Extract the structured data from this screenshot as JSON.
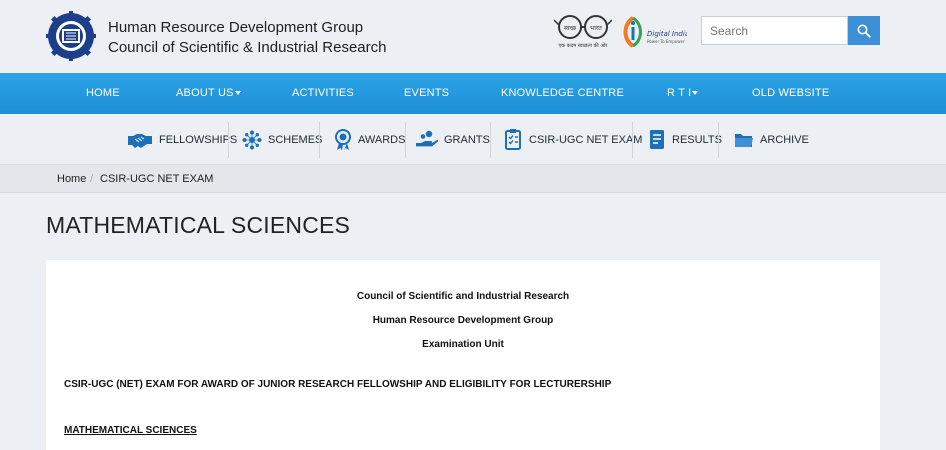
{
  "header": {
    "org_line1": "Human Resource Development Group",
    "org_line2": "Council of Scientific & Industrial Research",
    "swachh_text": "एक कदम स्वच्छता की ओर",
    "swachh_badge_left": "स्वच्छ",
    "swachh_badge_right": "भारत",
    "digital_india_title": "Digital India",
    "digital_india_sub": "Power To Empower",
    "search_placeholder": "Search"
  },
  "main_nav": {
    "home": "HOME",
    "about": "ABOUT US",
    "activities": "ACTIVITIES",
    "events": "EVENTS",
    "knowledge": "KNOWLEDGE CENTRE",
    "rti": "R T I",
    "old_website": "OLD WEBSITE"
  },
  "sub_nav": {
    "fellowships": "FELLOWSHIPS",
    "schemes": "SCHEMES",
    "awards": "AWARDS",
    "grants": "GRANTS",
    "net_exam": "CSIR-UGC NET EXAM",
    "results": "RESULTS",
    "archive": "ARCHIVE"
  },
  "breadcrumb": {
    "home": "Home",
    "separator": "/",
    "current": "CSIR-UGC NET EXAM"
  },
  "page_title": "MATHEMATICAL SCIENCES",
  "content": {
    "line1": "Council of Scientific and Industrial Research",
    "line2": "Human Resource Development Group",
    "line3": "Examination Unit",
    "heading": "CSIR-UGC (NET) EXAM FOR AWARD OF JUNIOR RESEARCH FELLOWSHIP AND ELIGIBILITY FOR LECTURERSHIP",
    "subheading": "MATHEMATICAL SCIENCES"
  },
  "colors": {
    "nav_blue": "#1e8fd6",
    "icon_blue": "#1d6fb8",
    "search_button": "#3b8fd6"
  }
}
